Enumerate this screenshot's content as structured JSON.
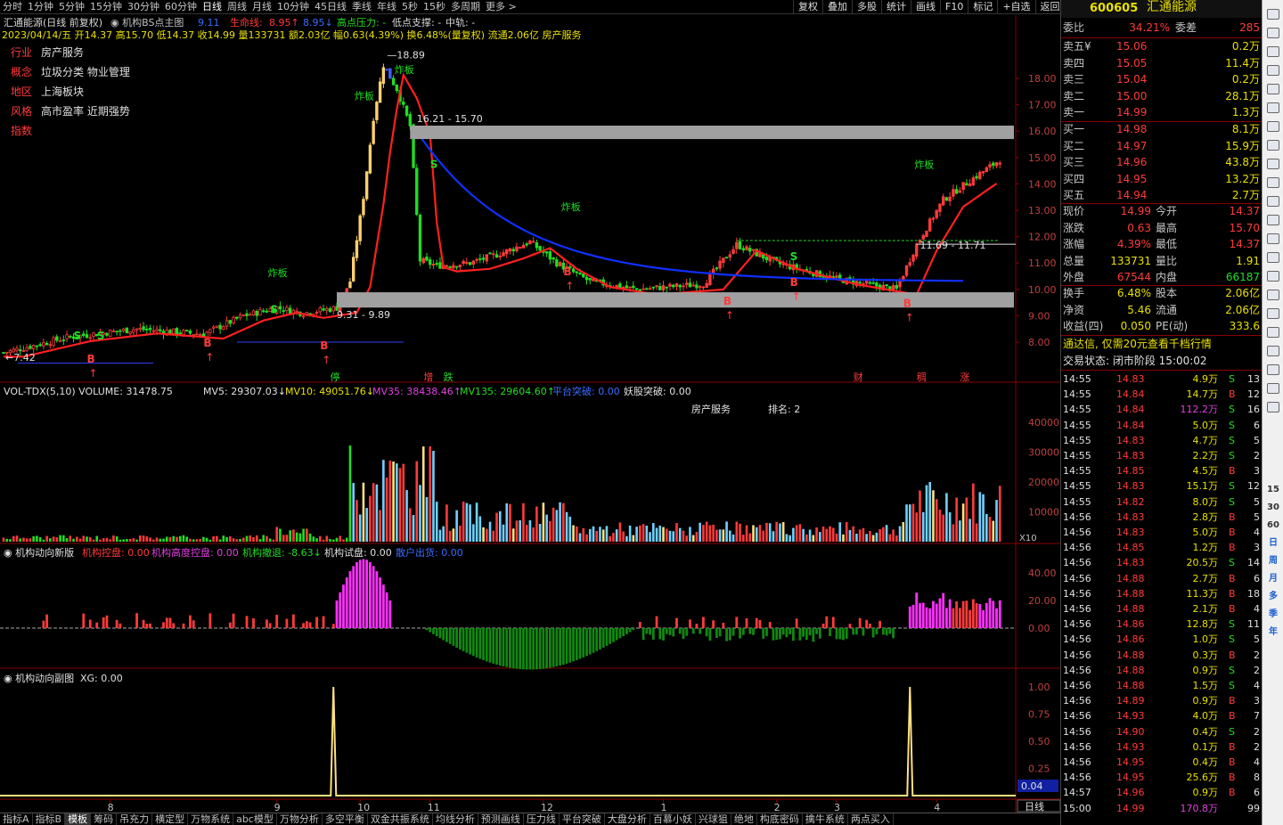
{
  "topbar": {
    "items": [
      "分时",
      "1分钟",
      "5分钟",
      "15分钟",
      "30分钟",
      "60分钟",
      "日线",
      "周线",
      "月线",
      "10分钟",
      "45日线",
      "季线",
      "年线",
      "5秒",
      "15秒",
      "多周期",
      "更多 >"
    ],
    "active": 6,
    "right": [
      "复权",
      "叠加",
      "多股",
      "统计",
      "画线",
      "F10",
      "标记",
      "+自选",
      "返回"
    ]
  },
  "header": {
    "title": "汇通能源(日线 前复权)",
    "indicator": "机构BS点主图",
    "v1": "9.11",
    "v1_label": "生命线:",
    "v2": "8.95",
    "v3": "8.95",
    "resist": "高点压力: -",
    "support": "低点支撑: -",
    "mid": "中轨: -",
    "line2": "2023/04/14/五 开14.37 高15.70 低14.37 收14.99 量133731 额2.03亿 幅0.63(4.39%) 换6.48%(量复权) 流通2.06亿 房产服务"
  },
  "info": {
    "rows": [
      {
        "k": "行业",
        "v": "房产服务"
      },
      {
        "k": "概念",
        "v": "垃圾分类 物业管理"
      },
      {
        "k": "地区",
        "v": "上海板块"
      },
      {
        "k": "风格",
        "v": "高市盈率 近期强势"
      },
      {
        "k": "指数",
        "v": ""
      }
    ]
  },
  "chart": {
    "price_ticks": [
      "18.00",
      "17.00",
      "16.00",
      "15.00",
      "14.00",
      "13.00",
      "12.00",
      "11.00",
      "10.00",
      "9.00",
      "8.00"
    ],
    "labels": {
      "hi": "18.89",
      "zone_hi": "16.21 - 15.70",
      "zone_lo": "9.31 - 9.89",
      "zone_mid": "11.69 - 11.71",
      "low": "7.42",
      "zha": "炸板",
      "ting": "停",
      "zeng": "增",
      "die": "跌",
      "cai": "财",
      "chou": "稠",
      "zhang": "涨"
    },
    "months": [
      "8",
      "9",
      "10",
      "11",
      "12",
      "1",
      "2",
      "3",
      "4"
    ]
  },
  "vol": {
    "title": "VOL-TDX(5,10) VOLUME: 31478.75",
    "mv5": "MV5: 29307.03",
    "mv10": "MV10: 49051.76",
    "mv35": "MV35: 38438.46",
    "mv135": "MV135: 29604.60",
    "s1": "平台突破: 0.00",
    "s2": "妖股突破: 0.00",
    "s3": "房产服务",
    "s4": "排名: 2",
    "ticks": [
      "40000",
      "30000",
      "20000",
      "10000"
    ],
    "x10": "X10"
  },
  "ind1": {
    "title": "机构动向新版",
    "a": "机构控盘: 0.00",
    "b": "机构高度控盘: 0.00",
    "c": "机构撤退: -8.63",
    "d": "机构试盘: 0.00",
    "e": "散户出货: 0.00",
    "ticks": [
      "40.00",
      "20.00",
      "0.00"
    ]
  },
  "ind2": {
    "title": "机构动向副图",
    "xg": "XG: 0.00",
    "ticks": [
      "1.00",
      "0.75",
      "0.50",
      "0.25"
    ],
    "cur": "0.04"
  },
  "rpanel": {
    "code": "600605",
    "name": "汇通能源",
    "weibi_label": "委比",
    "weibi": "34.21%",
    "weicha_label": "委差",
    "weicha": "285",
    "asks": [
      {
        "l": "卖五¥",
        "p": "15.06",
        "v": "0.2万"
      },
      {
        "l": "卖四",
        "p": "15.05",
        "v": "11.4万"
      },
      {
        "l": "卖三",
        "p": "15.04",
        "v": "0.2万"
      },
      {
        "l": "卖二",
        "p": "15.00",
        "v": "28.1万"
      },
      {
        "l": "卖一",
        "p": "14.99",
        "v": "1.3万"
      }
    ],
    "bids": [
      {
        "l": "买一",
        "p": "14.98",
        "v": "8.1万"
      },
      {
        "l": "买二",
        "p": "14.97",
        "v": "15.9万"
      },
      {
        "l": "买三",
        "p": "14.96",
        "v": "43.8万"
      },
      {
        "l": "买四",
        "p": "14.95",
        "v": "13.2万"
      },
      {
        "l": "买五",
        "p": "14.94",
        "v": "2.7万"
      }
    ],
    "stats": [
      {
        "a": "现价",
        "b": "14.99",
        "c": "今开",
        "d": "14.37"
      },
      {
        "a": "涨跌",
        "b": "0.63",
        "c": "最高",
        "d": "15.70"
      },
      {
        "a": "涨幅",
        "b": "4.39%",
        "c": "最低",
        "d": "14.37"
      },
      {
        "a": "总量",
        "b": "133731",
        "c": "量比",
        "d": "1.91"
      },
      {
        "a": "外盘",
        "b": "67544",
        "c": "内盘",
        "d": "66187"
      }
    ],
    "stats2": [
      {
        "a": "换手",
        "b": "6.48%",
        "c": "股本",
        "d": "2.06亿"
      },
      {
        "a": "净资",
        "b": "5.46",
        "c": "流通",
        "d": "2.06亿"
      },
      {
        "a": "收益(四)",
        "b": "0.050",
        "c": "PE(动)",
        "d": "333.6"
      }
    ],
    "ad": "通达信, 仅需20元查看千档行情",
    "status": "交易状态: 闭市阶段 15:00:02",
    "ticks": [
      {
        "t": "14:55",
        "p": "14.83",
        "v": "4.9万",
        "s": "S",
        "n": "13"
      },
      {
        "t": "14:55",
        "p": "14.84",
        "v": "14.7万",
        "s": "B",
        "n": "12"
      },
      {
        "t": "14:55",
        "p": "14.84",
        "v": "112.2万",
        "s": "S",
        "n": "16"
      },
      {
        "t": "14:55",
        "p": "14.84",
        "v": "5.0万",
        "s": "S",
        "n": "6"
      },
      {
        "t": "14:55",
        "p": "14.83",
        "v": "4.7万",
        "s": "S",
        "n": "5"
      },
      {
        "t": "14:55",
        "p": "14.83",
        "v": "2.2万",
        "s": "S",
        "n": "2"
      },
      {
        "t": "14:55",
        "p": "14.85",
        "v": "4.5万",
        "s": "B",
        "n": "3"
      },
      {
        "t": "14:55",
        "p": "14.83",
        "v": "15.1万",
        "s": "S",
        "n": "12"
      },
      {
        "t": "14:55",
        "p": "14.82",
        "v": "8.0万",
        "s": "S",
        "n": "5"
      },
      {
        "t": "14:56",
        "p": "14.83",
        "v": "2.8万",
        "s": "B",
        "n": "5"
      },
      {
        "t": "14:56",
        "p": "14.83",
        "v": "5.0万",
        "s": "B",
        "n": "4"
      },
      {
        "t": "14:56",
        "p": "14.85",
        "v": "1.2万",
        "s": "B",
        "n": "3"
      },
      {
        "t": "14:56",
        "p": "14.83",
        "v": "20.5万",
        "s": "S",
        "n": "14"
      },
      {
        "t": "14:56",
        "p": "14.88",
        "v": "2.7万",
        "s": "B",
        "n": "6"
      },
      {
        "t": "14:56",
        "p": "14.88",
        "v": "11.3万",
        "s": "B",
        "n": "18"
      },
      {
        "t": "14:56",
        "p": "14.88",
        "v": "2.1万",
        "s": "B",
        "n": "4"
      },
      {
        "t": "14:56",
        "p": "14.86",
        "v": "12.8万",
        "s": "S",
        "n": "11"
      },
      {
        "t": "14:56",
        "p": "14.86",
        "v": "1.0万",
        "s": "S",
        "n": "5"
      },
      {
        "t": "14:56",
        "p": "14.88",
        "v": "0.3万",
        "s": "B",
        "n": "2"
      },
      {
        "t": "14:56",
        "p": "14.88",
        "v": "0.9万",
        "s": "S",
        "n": "2"
      },
      {
        "t": "14:56",
        "p": "14.88",
        "v": "1.5万",
        "s": "S",
        "n": "4"
      },
      {
        "t": "14:56",
        "p": "14.89",
        "v": "0.9万",
        "s": "B",
        "n": "3"
      },
      {
        "t": "14:56",
        "p": "14.93",
        "v": "4.0万",
        "s": "B",
        "n": "7"
      },
      {
        "t": "14:56",
        "p": "14.90",
        "v": "0.4万",
        "s": "S",
        "n": "2"
      },
      {
        "t": "14:56",
        "p": "14.93",
        "v": "0.1万",
        "s": "B",
        "n": "2"
      },
      {
        "t": "14:56",
        "p": "14.95",
        "v": "0.4万",
        "s": "B",
        "n": "4"
      },
      {
        "t": "14:56",
        "p": "14.95",
        "v": "25.6万",
        "s": "B",
        "n": "8"
      },
      {
        "t": "14:57",
        "p": "14.96",
        "v": "0.9万",
        "s": "B",
        "n": "6"
      },
      {
        "t": "15:00",
        "p": "14.99",
        "v": "170.8万",
        "s": "",
        "n": "99"
      }
    ]
  },
  "ftool": [
    "15",
    "30",
    "60",
    "日",
    "周",
    "月",
    "多",
    "季",
    "年"
  ],
  "bottombar": [
    "指标A",
    "指标B",
    "模板",
    "筹码",
    "吊充力",
    "横定型",
    "万物系统",
    "abc模型",
    "万物分析",
    "多空平衡",
    "双金共振系统",
    "均线分析",
    "预测画线",
    "压力线",
    "平台突破",
    "大盘分析",
    "百慕小妖",
    "兴球狙",
    "绝地",
    "构底密码",
    "擒牛系统",
    "两点买入"
  ],
  "bottom_right": "日线",
  "colors": {
    "up": "#ff3b3b",
    "down": "#22dd22",
    "yellow": "#e8e000",
    "bg": "#000000"
  }
}
